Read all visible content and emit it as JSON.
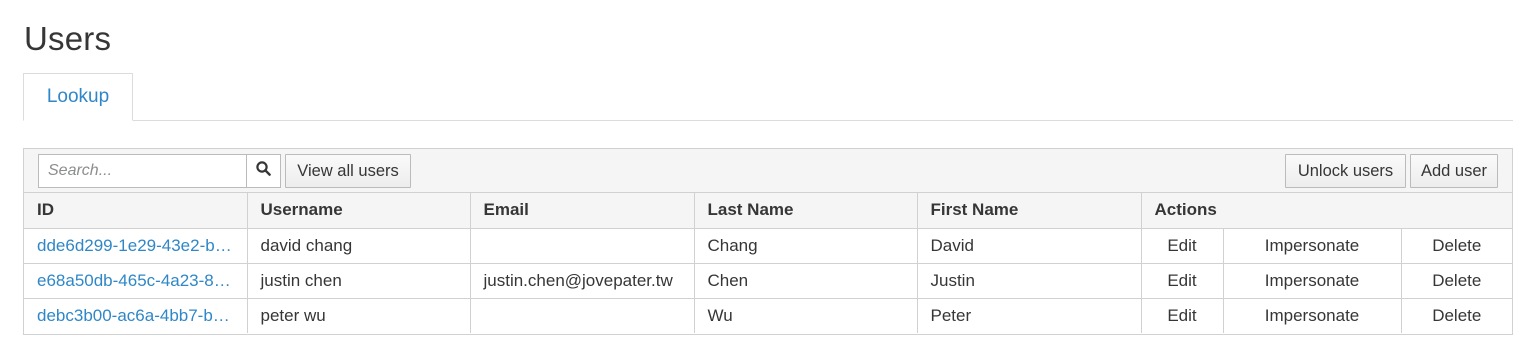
{
  "page": {
    "title": "Users"
  },
  "tabs": [
    {
      "label": "Lookup"
    }
  ],
  "toolbar": {
    "search_placeholder": "Search...",
    "view_all_label": "View all users",
    "unlock_label": "Unlock users",
    "add_label": "Add user"
  },
  "table": {
    "headers": {
      "id": "ID",
      "username": "Username",
      "email": "Email",
      "last_name": "Last Name",
      "first_name": "First Name",
      "actions": "Actions"
    },
    "rows": [
      {
        "id": "dde6d299-1e29-43e2-b…",
        "username": "david chang",
        "email": "",
        "last_name": "Chang",
        "first_name": "David",
        "edit": "Edit",
        "impersonate": "Impersonate",
        "delete": "Delete"
      },
      {
        "id": "e68a50db-465c-4a23-8…",
        "username": "justin chen",
        "email": "justin.chen@jovepater.tw",
        "last_name": "Chen",
        "first_name": "Justin",
        "edit": "Edit",
        "impersonate": "Impersonate",
        "delete": "Delete"
      },
      {
        "id": "debc3b00-ac6a-4bb7-b…",
        "username": "peter wu",
        "email": "",
        "last_name": "Wu",
        "first_name": "Peter",
        "edit": "Edit",
        "impersonate": "Impersonate",
        "delete": "Delete"
      }
    ]
  },
  "icons": {
    "search": "search-icon"
  },
  "colors": {
    "link": "#2f87c7",
    "header_bg": "#f5f5f5",
    "border": "#d1d1d1"
  }
}
